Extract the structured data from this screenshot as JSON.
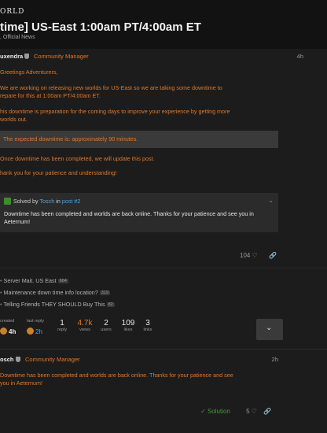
{
  "header": {
    "logo": "ORLD",
    "title": "time] US-East 1:00am PT/4:00am ET",
    "category": ", Official News"
  },
  "post1": {
    "author": "uxendra",
    "role": "Community Manager",
    "time": "4h",
    "greeting": "Greetings Adventurers,",
    "line1a": "We are working on releasing new worlds for US-East so we are taking some downtime to",
    "line1b": "repare for this at 1:00am PT/4:00am ET.",
    "line2a": "his downtime is preparation for the coming days to improve your experience by getting more",
    "line2b": "worlds out.",
    "callout": "The expected downtime is: approximately 90 minutes.",
    "line3": "Once downtime has been completed, we will update this post.",
    "line4": "hank you for your patience and understanding!",
    "solved": {
      "prefix": "Solved by",
      "user": "Tosch",
      "mid": "in",
      "post_link": "post #2",
      "body": "Downtime has been completed and worlds are back online. Thanks for your patience and see you in Aeternum!"
    },
    "likes": "104"
  },
  "related": [
    {
      "title": "Server Mait. US East",
      "count": "664"
    },
    {
      "title": "Maintenance down time info location?",
      "count": "319"
    },
    {
      "title": "Telling Friends THEY SHOULD Buy This",
      "count": "82"
    }
  ],
  "stats": {
    "created_label": "created",
    "created_value": "4h",
    "last_reply_label": "last reply",
    "last_reply_value": "2h",
    "replies_value": "1",
    "replies_label": "reply",
    "views_value": "4.7k",
    "views_label": "views",
    "users_value": "2",
    "users_label": "users",
    "likes_value": "109",
    "likes_label": "likes",
    "links_value": "3",
    "links_label": "links"
  },
  "post2": {
    "author": "osch",
    "role": "Community Manager",
    "time": "2h",
    "line1": "Downtime has been completed and worlds are back online. Thanks for your patience and see",
    "line2": "you in Aeternum!",
    "solution_label": "Solution",
    "likes": "5"
  }
}
